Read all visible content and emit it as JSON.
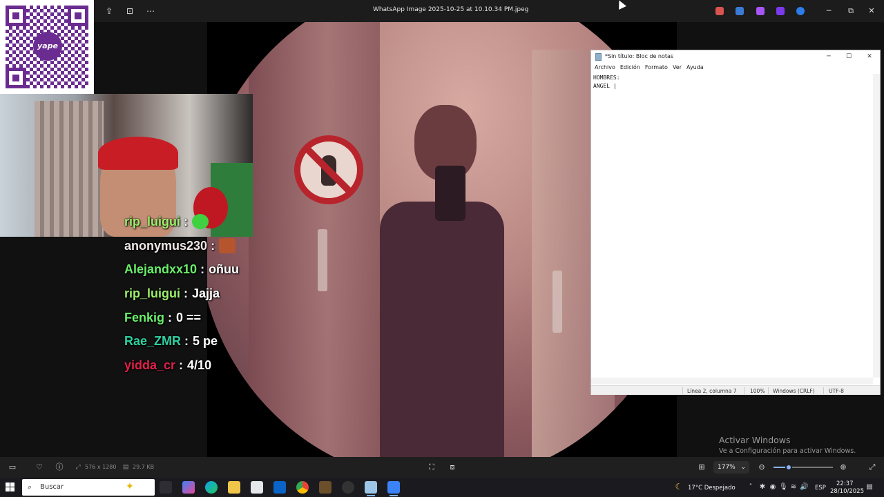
{
  "viewer": {
    "title": "WhatsApp Image 2025-10-25 at 10.10.34 PM.jpeg",
    "image_info": "576 x 1280",
    "file_size": "29.7 KB",
    "zoom": "177%",
    "zoom_level": 0.25
  },
  "qr": {
    "logo_text": "yape"
  },
  "chat": [
    {
      "user": "rip_luigui",
      "user_color": "#9df06a",
      "sep": ":",
      "msg": "",
      "emote": "green-smiley"
    },
    {
      "user": "anonymus230",
      "user_color": "#f0e6e6",
      "sep": ":",
      "msg": "",
      "emote": "face-emote"
    },
    {
      "user": "Alejandxx10",
      "user_color": "#6af06a",
      "sep": ":",
      "msg": "oñuu"
    },
    {
      "user": "rip_luigui",
      "user_color": "#9df06a",
      "sep": ":",
      "msg": "Jajja"
    },
    {
      "user": "Fenkig",
      "user_color": "#6af06a",
      "sep": ":",
      "msg": "0 =="
    },
    {
      "user": "Rae_ZMR",
      "user_color": "#2fd0a0",
      "sep": ":",
      "msg": "5 pe"
    },
    {
      "user": "yidda_cr",
      "user_color": "#e0204a",
      "sep": ":",
      "msg": "4/10"
    }
  ],
  "notepad": {
    "title": "*Sin título: Bloc de notas",
    "menu": [
      "Archivo",
      "Edición",
      "Formato",
      "Ver",
      "Ayuda"
    ],
    "content": "HOMBRES:\nANGEL |",
    "status": {
      "position": "Línea 2, columna 7",
      "zoom": "100%",
      "eol": "Windows (CRLF)",
      "encoding": "UTF-8"
    }
  },
  "watermark": {
    "line1": "Activar Windows",
    "line2": "Ve a Configuración para activar Windows."
  },
  "taskbar": {
    "search_placeholder": "Buscar",
    "weather": "17°C  Despejado",
    "language": "ESP",
    "time": "22:37",
    "date": "28/10/2025"
  }
}
